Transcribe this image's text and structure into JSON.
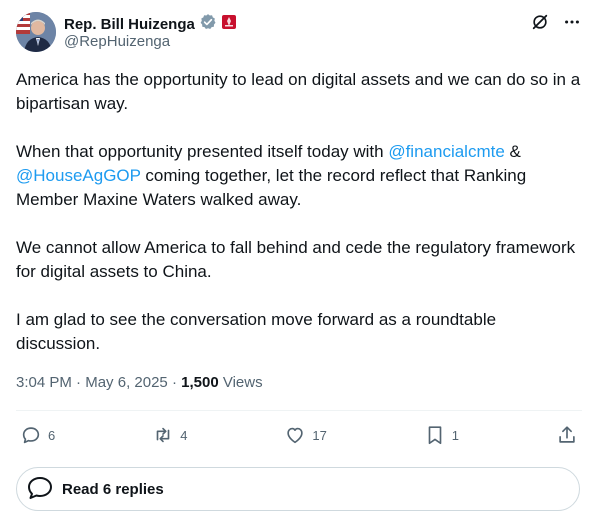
{
  "author": {
    "name": "Rep. Bill Huizenga",
    "handle": "@RepHuizenga",
    "verified_badge": "verified-badge-icon",
    "affiliation_badge": "congress-badge-icon"
  },
  "post": {
    "p1": "America has the opportunity to lead on digital assets and we can do so in a bipartisan way.",
    "p2_a": "When that opportunity presented itself today with ",
    "mention1": "@financialcmte",
    "p2_b": " & ",
    "mention2": "@HouseAgGOP",
    "p2_c": " coming together, let the record reflect that Ranking Member Maxine Waters walked away.",
    "p3": "We cannot allow America to fall behind and cede the regulatory framework for digital assets to China.",
    "p4": "I am glad to see the conversation move forward as a roundtable discussion."
  },
  "meta": {
    "time": "3:04 PM",
    "sep1": " · ",
    "date": "May 6, 2025",
    "sep2": " · ",
    "views_count": "1,500",
    "views_label": " Views"
  },
  "actions": {
    "replies": "6",
    "reposts": "4",
    "likes": "17",
    "bookmarks": "1"
  },
  "read_replies": {
    "label": "Read 6 replies"
  },
  "colors": {
    "link": "#1d9bf0",
    "muted": "#536471",
    "text": "#0f1419"
  }
}
